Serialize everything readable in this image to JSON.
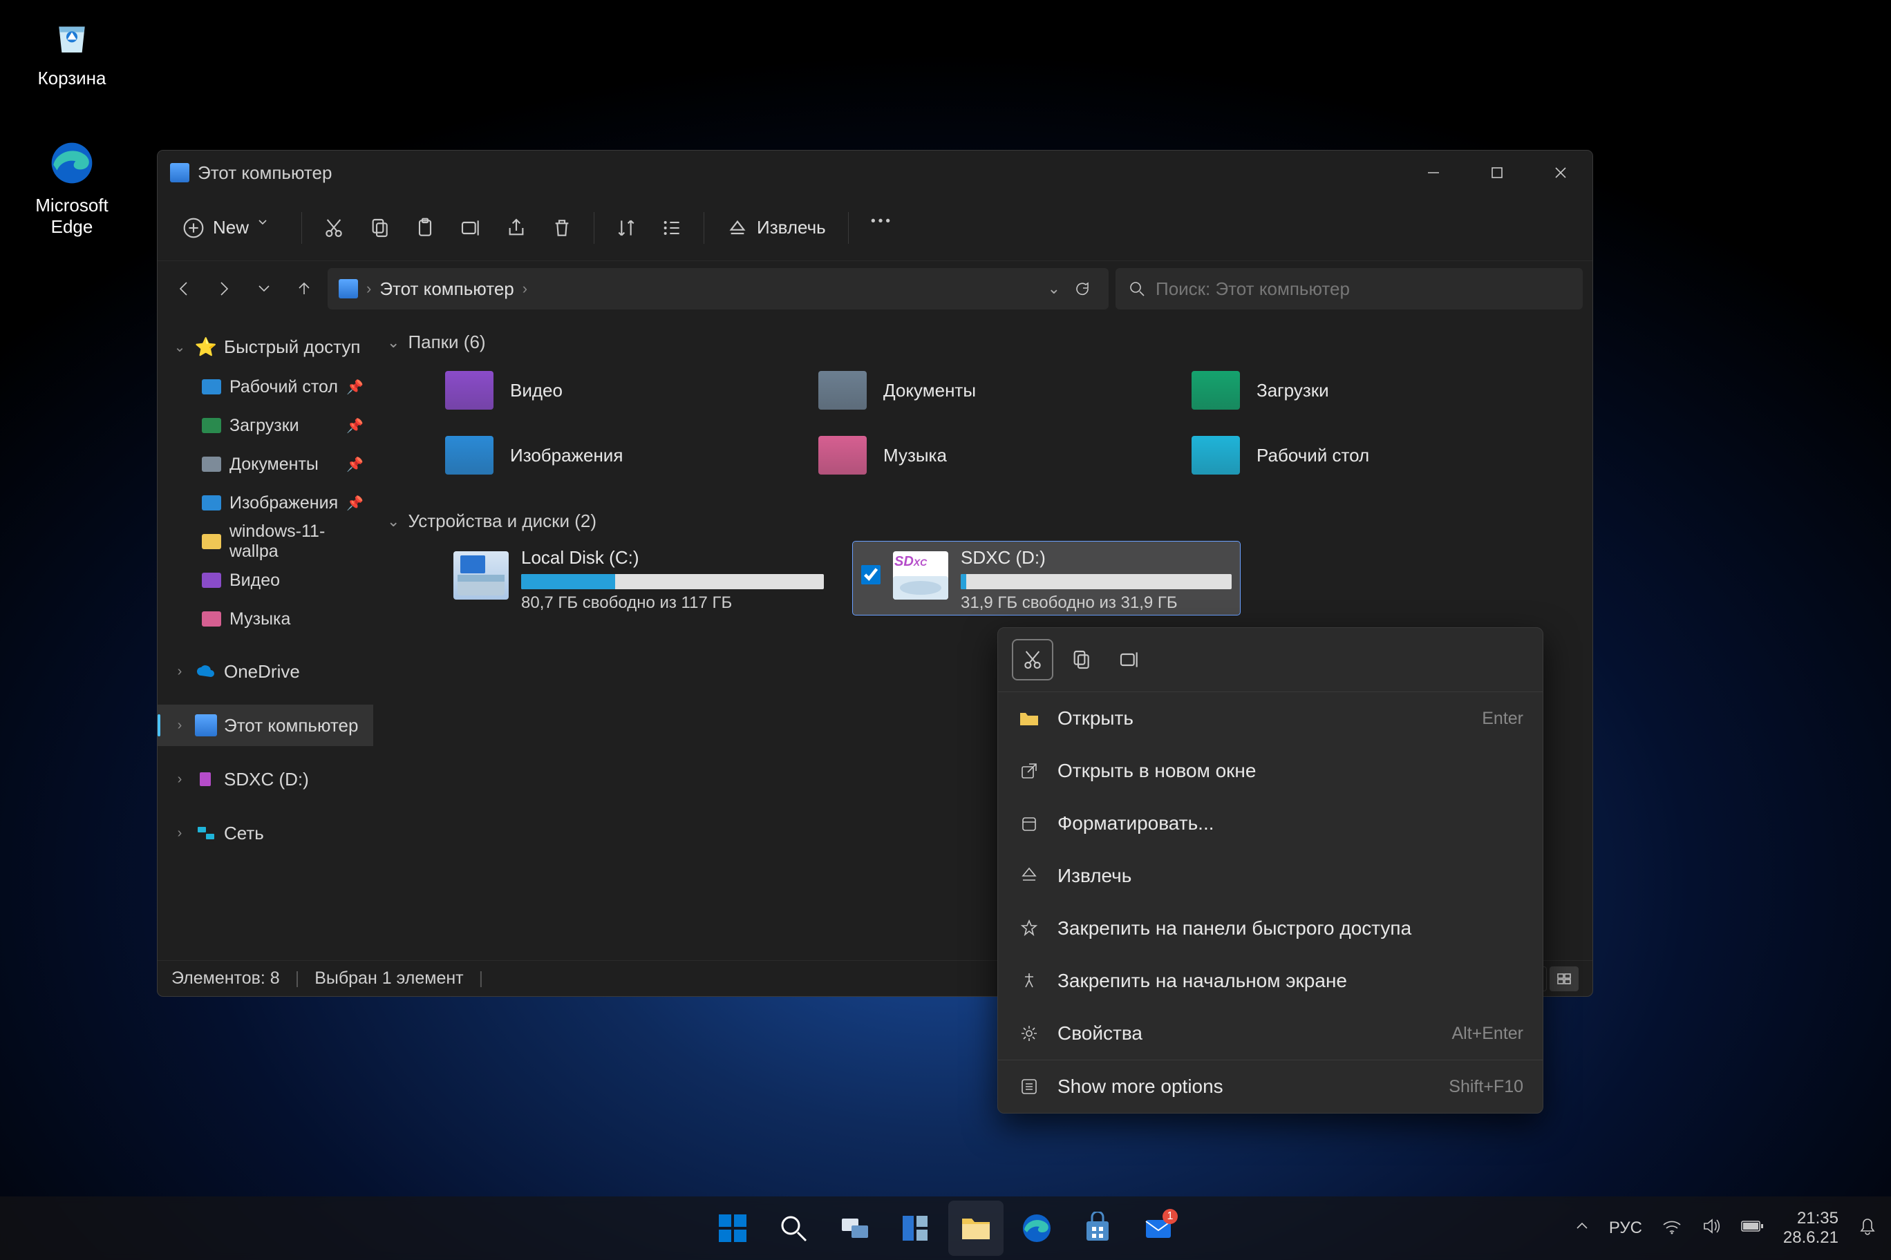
{
  "desktop": {
    "recycle_bin": "Корзина",
    "edge": "Microsoft Edge"
  },
  "window": {
    "title": "Этот компьютер"
  },
  "ribbon": {
    "new": "New",
    "eject": "Извлечь"
  },
  "nav": {
    "location": "Этот компьютер",
    "search_placeholder": "Поиск: Этот компьютер"
  },
  "sidebar": {
    "quick": "Быстрый доступ",
    "quick_children": [
      {
        "label": "Рабочий стол",
        "ic": "desktop-icon",
        "pinned": true,
        "color": "#2a8ad6"
      },
      {
        "label": "Загрузки",
        "ic": "downloads-icon",
        "pinned": true,
        "color": "#2a8a4e"
      },
      {
        "label": "Документы",
        "ic": "documents-icon",
        "pinned": true,
        "color": "#7d8b99"
      },
      {
        "label": "Изображения",
        "ic": "pictures-icon",
        "pinned": true,
        "color": "#2a8ad6"
      },
      {
        "label": "windows-11-wallpa",
        "ic": "folder-icon",
        "pinned": false,
        "color": "#f0c755"
      },
      {
        "label": "Видео",
        "ic": "video-icon",
        "pinned": false,
        "color": "#8a4cc9"
      },
      {
        "label": "Музыка",
        "ic": "music-icon",
        "pinned": false,
        "color": "#d65f91"
      }
    ],
    "onedrive": "OneDrive",
    "this_pc": "Этот компьютер",
    "sdxc": "SDXC (D:)",
    "network": "Сеть"
  },
  "groups": {
    "folders_header": "Папки (6)",
    "drives_header": "Устройства и диски (2)"
  },
  "folders": [
    {
      "label": "Видео",
      "color": "#8a4cc9",
      "ic": "video-folder-icon"
    },
    {
      "label": "Документы",
      "color": "#6c7f91",
      "ic": "documents-folder-icon"
    },
    {
      "label": "Загрузки",
      "color": "#15a36e",
      "ic": "downloads-folder-icon"
    },
    {
      "label": "Изображения",
      "color": "#2a8ad6",
      "ic": "pictures-folder-icon"
    },
    {
      "label": "Музыка",
      "color": "#d65f91",
      "ic": "music-folder-icon"
    },
    {
      "label": "Рабочий стол",
      "color": "#1fb4d9",
      "ic": "desktop-folder-icon"
    }
  ],
  "drives": {
    "c": {
      "name": "Local Disk (C:)",
      "free": "80,7 ГБ свободно из 117 ГБ",
      "fill_pct": 31
    },
    "d": {
      "name": "SDXC (D:)",
      "free": "31,9 ГБ свободно из 31,9 ГБ",
      "fill_pct": 2
    }
  },
  "status": {
    "items": "Элементов: 8",
    "selected": "Выбран 1 элемент"
  },
  "context": {
    "open": "Открыть",
    "open_shortcut": "Enter",
    "open_new": "Открыть в новом окне",
    "format": "Форматировать...",
    "eject": "Извлечь",
    "pin_quick": "Закрепить на панели быстрого доступа",
    "pin_start": "Закрепить на начальном экране",
    "properties": "Свойства",
    "properties_sc": "Alt+Enter",
    "more": "Show more options",
    "more_sc": "Shift+F10"
  },
  "tray": {
    "lang": "РУС",
    "time": "21:35",
    "date": "28.6.21"
  }
}
